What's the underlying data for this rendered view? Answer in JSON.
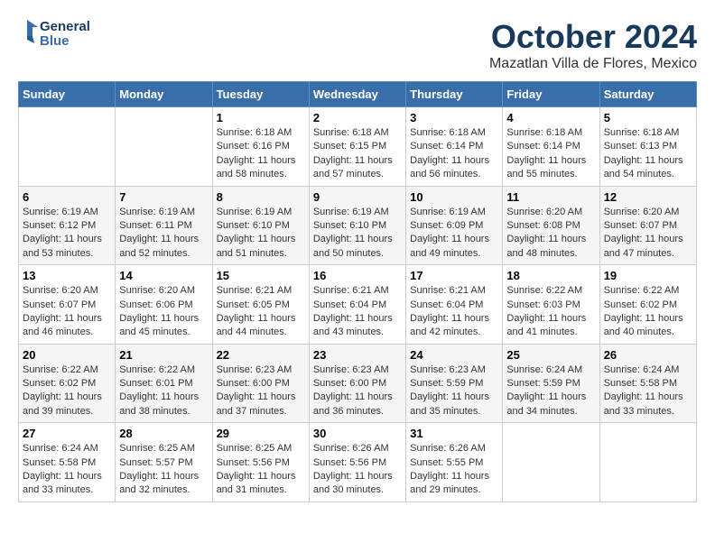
{
  "header": {
    "logo_line1": "General",
    "logo_line2": "Blue",
    "month_year": "October 2024",
    "location": "Mazatlan Villa de Flores, Mexico"
  },
  "days_of_week": [
    "Sunday",
    "Monday",
    "Tuesday",
    "Wednesday",
    "Thursday",
    "Friday",
    "Saturday"
  ],
  "weeks": [
    [
      {
        "day": "",
        "sunrise": "",
        "sunset": "",
        "daylight": ""
      },
      {
        "day": "",
        "sunrise": "",
        "sunset": "",
        "daylight": ""
      },
      {
        "day": "1",
        "sunrise": "Sunrise: 6:18 AM",
        "sunset": "Sunset: 6:16 PM",
        "daylight": "Daylight: 11 hours and 58 minutes."
      },
      {
        "day": "2",
        "sunrise": "Sunrise: 6:18 AM",
        "sunset": "Sunset: 6:15 PM",
        "daylight": "Daylight: 11 hours and 57 minutes."
      },
      {
        "day": "3",
        "sunrise": "Sunrise: 6:18 AM",
        "sunset": "Sunset: 6:14 PM",
        "daylight": "Daylight: 11 hours and 56 minutes."
      },
      {
        "day": "4",
        "sunrise": "Sunrise: 6:18 AM",
        "sunset": "Sunset: 6:14 PM",
        "daylight": "Daylight: 11 hours and 55 minutes."
      },
      {
        "day": "5",
        "sunrise": "Sunrise: 6:18 AM",
        "sunset": "Sunset: 6:13 PM",
        "daylight": "Daylight: 11 hours and 54 minutes."
      }
    ],
    [
      {
        "day": "6",
        "sunrise": "Sunrise: 6:19 AM",
        "sunset": "Sunset: 6:12 PM",
        "daylight": "Daylight: 11 hours and 53 minutes."
      },
      {
        "day": "7",
        "sunrise": "Sunrise: 6:19 AM",
        "sunset": "Sunset: 6:11 PM",
        "daylight": "Daylight: 11 hours and 52 minutes."
      },
      {
        "day": "8",
        "sunrise": "Sunrise: 6:19 AM",
        "sunset": "Sunset: 6:10 PM",
        "daylight": "Daylight: 11 hours and 51 minutes."
      },
      {
        "day": "9",
        "sunrise": "Sunrise: 6:19 AM",
        "sunset": "Sunset: 6:10 PM",
        "daylight": "Daylight: 11 hours and 50 minutes."
      },
      {
        "day": "10",
        "sunrise": "Sunrise: 6:19 AM",
        "sunset": "Sunset: 6:09 PM",
        "daylight": "Daylight: 11 hours and 49 minutes."
      },
      {
        "day": "11",
        "sunrise": "Sunrise: 6:20 AM",
        "sunset": "Sunset: 6:08 PM",
        "daylight": "Daylight: 11 hours and 48 minutes."
      },
      {
        "day": "12",
        "sunrise": "Sunrise: 6:20 AM",
        "sunset": "Sunset: 6:07 PM",
        "daylight": "Daylight: 11 hours and 47 minutes."
      }
    ],
    [
      {
        "day": "13",
        "sunrise": "Sunrise: 6:20 AM",
        "sunset": "Sunset: 6:07 PM",
        "daylight": "Daylight: 11 hours and 46 minutes."
      },
      {
        "day": "14",
        "sunrise": "Sunrise: 6:20 AM",
        "sunset": "Sunset: 6:06 PM",
        "daylight": "Daylight: 11 hours and 45 minutes."
      },
      {
        "day": "15",
        "sunrise": "Sunrise: 6:21 AM",
        "sunset": "Sunset: 6:05 PM",
        "daylight": "Daylight: 11 hours and 44 minutes."
      },
      {
        "day": "16",
        "sunrise": "Sunrise: 6:21 AM",
        "sunset": "Sunset: 6:04 PM",
        "daylight": "Daylight: 11 hours and 43 minutes."
      },
      {
        "day": "17",
        "sunrise": "Sunrise: 6:21 AM",
        "sunset": "Sunset: 6:04 PM",
        "daylight": "Daylight: 11 hours and 42 minutes."
      },
      {
        "day": "18",
        "sunrise": "Sunrise: 6:22 AM",
        "sunset": "Sunset: 6:03 PM",
        "daylight": "Daylight: 11 hours and 41 minutes."
      },
      {
        "day": "19",
        "sunrise": "Sunrise: 6:22 AM",
        "sunset": "Sunset: 6:02 PM",
        "daylight": "Daylight: 11 hours and 40 minutes."
      }
    ],
    [
      {
        "day": "20",
        "sunrise": "Sunrise: 6:22 AM",
        "sunset": "Sunset: 6:02 PM",
        "daylight": "Daylight: 11 hours and 39 minutes."
      },
      {
        "day": "21",
        "sunrise": "Sunrise: 6:22 AM",
        "sunset": "Sunset: 6:01 PM",
        "daylight": "Daylight: 11 hours and 38 minutes."
      },
      {
        "day": "22",
        "sunrise": "Sunrise: 6:23 AM",
        "sunset": "Sunset: 6:00 PM",
        "daylight": "Daylight: 11 hours and 37 minutes."
      },
      {
        "day": "23",
        "sunrise": "Sunrise: 6:23 AM",
        "sunset": "Sunset: 6:00 PM",
        "daylight": "Daylight: 11 hours and 36 minutes."
      },
      {
        "day": "24",
        "sunrise": "Sunrise: 6:23 AM",
        "sunset": "Sunset: 5:59 PM",
        "daylight": "Daylight: 11 hours and 35 minutes."
      },
      {
        "day": "25",
        "sunrise": "Sunrise: 6:24 AM",
        "sunset": "Sunset: 5:59 PM",
        "daylight": "Daylight: 11 hours and 34 minutes."
      },
      {
        "day": "26",
        "sunrise": "Sunrise: 6:24 AM",
        "sunset": "Sunset: 5:58 PM",
        "daylight": "Daylight: 11 hours and 33 minutes."
      }
    ],
    [
      {
        "day": "27",
        "sunrise": "Sunrise: 6:24 AM",
        "sunset": "Sunset: 5:58 PM",
        "daylight": "Daylight: 11 hours and 33 minutes."
      },
      {
        "day": "28",
        "sunrise": "Sunrise: 6:25 AM",
        "sunset": "Sunset: 5:57 PM",
        "daylight": "Daylight: 11 hours and 32 minutes."
      },
      {
        "day": "29",
        "sunrise": "Sunrise: 6:25 AM",
        "sunset": "Sunset: 5:56 PM",
        "daylight": "Daylight: 11 hours and 31 minutes."
      },
      {
        "day": "30",
        "sunrise": "Sunrise: 6:26 AM",
        "sunset": "Sunset: 5:56 PM",
        "daylight": "Daylight: 11 hours and 30 minutes."
      },
      {
        "day": "31",
        "sunrise": "Sunrise: 6:26 AM",
        "sunset": "Sunset: 5:55 PM",
        "daylight": "Daylight: 11 hours and 29 minutes."
      },
      {
        "day": "",
        "sunrise": "",
        "sunset": "",
        "daylight": ""
      },
      {
        "day": "",
        "sunrise": "",
        "sunset": "",
        "daylight": ""
      }
    ]
  ]
}
